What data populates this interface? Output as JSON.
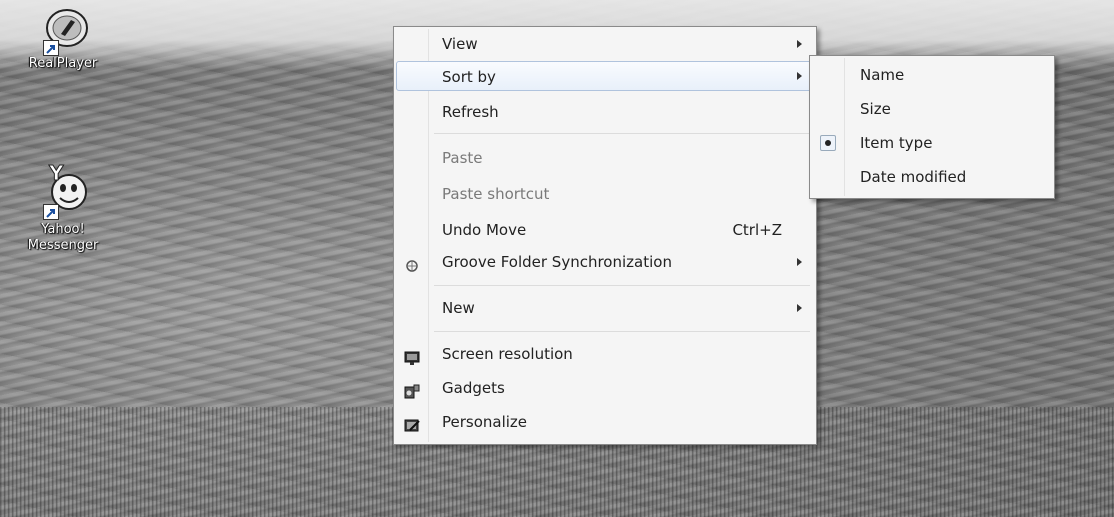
{
  "desktop_icons": [
    {
      "label": "RealPlayer",
      "icon": "realplayer-icon"
    },
    {
      "label_line1": "Yahoo!",
      "label_line2": "Messenger",
      "icon": "yahoo-messenger-icon"
    }
  ],
  "context_menu": {
    "items": [
      {
        "label": "View",
        "has_submenu": true
      },
      {
        "label": "Sort by",
        "has_submenu": true,
        "highlighted": true
      },
      {
        "label": "Refresh"
      },
      {
        "label": "Paste",
        "disabled": true
      },
      {
        "label": "Paste shortcut",
        "disabled": true
      },
      {
        "label": "Undo Move",
        "shortcut": "Ctrl+Z"
      },
      {
        "label": "Groove Folder Synchronization",
        "has_submenu": true,
        "icon": "groove-icon"
      },
      {
        "label": "New",
        "has_submenu": true
      },
      {
        "label": "Screen resolution",
        "icon": "screen-resolution-icon"
      },
      {
        "label": "Gadgets",
        "icon": "gadgets-icon"
      },
      {
        "label": "Personalize",
        "icon": "personalize-icon"
      }
    ]
  },
  "sort_submenu": {
    "items": [
      {
        "label": "Name"
      },
      {
        "label": "Size"
      },
      {
        "label": "Item type",
        "selected": true
      },
      {
        "label": "Date modified"
      }
    ]
  }
}
